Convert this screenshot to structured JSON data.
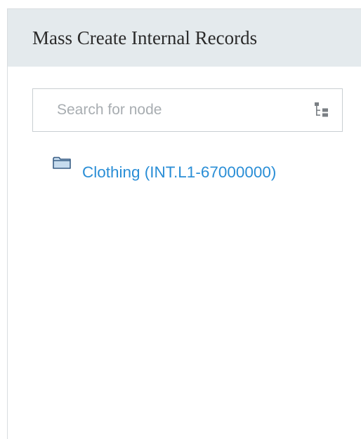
{
  "panel": {
    "title": "Mass Create Internal Records"
  },
  "search": {
    "placeholder": "Search for node",
    "value": "",
    "toggle_icon": "tree-view-icon"
  },
  "tree": {
    "nodes": [
      {
        "label": "Clothing (INT.L1-67000000)",
        "icon": "folder-icon"
      }
    ]
  },
  "colors": {
    "header_bg": "#e4eaed",
    "link": "#2a8ed6",
    "folder_fill": "#c7dcee",
    "folder_stroke": "#3a5f86"
  }
}
